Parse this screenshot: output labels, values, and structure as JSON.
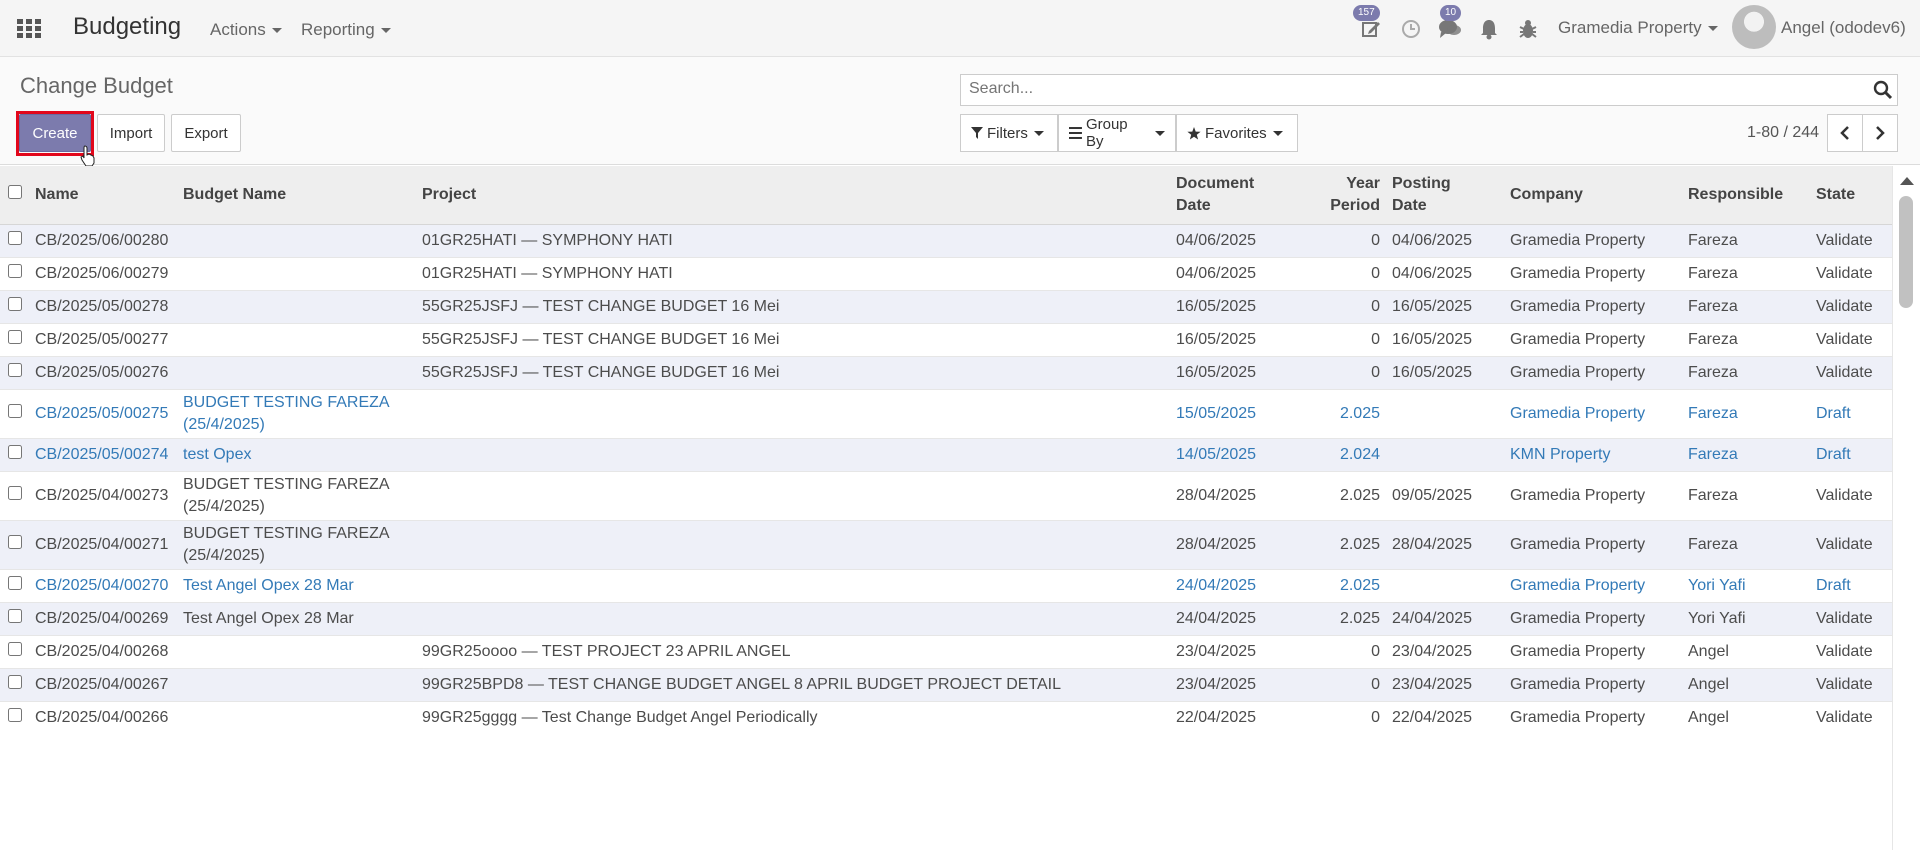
{
  "navbar": {
    "app_title": "Budgeting",
    "menus": [
      "Actions",
      "Reporting"
    ],
    "activity_count": "157",
    "messages_count": "10",
    "company": "Gramedia Property",
    "user": "Angel (ododev6)"
  },
  "control_panel": {
    "page_title": "Change Budget",
    "create_label": "Create",
    "import_label": "Import",
    "export_label": "Export",
    "search_placeholder": "Search...",
    "filters_label": "Filters",
    "groupby_label": "Group By",
    "favorites_label": "Favorites",
    "pager_value": "1-80 / 244"
  },
  "table": {
    "headers": {
      "name": "Name",
      "budget_name": "Budget Name",
      "project": "Project",
      "document_date_1": "Document",
      "document_date_2": "Date",
      "year_period_1": "Year",
      "year_period_2": "Period",
      "posting_date_1": "Posting",
      "posting_date_2": "Date",
      "company": "Company",
      "responsible": "Responsible",
      "state": "State"
    },
    "rows": [
      {
        "name": "CB/2025/06/00280",
        "budget_name": "",
        "project": "01GR25HATI — SYMPHONY HATI",
        "document_date": "04/06/2025",
        "year_period": "0",
        "posting_date": "04/06/2025",
        "company": "Gramedia Property",
        "responsible": "Fareza",
        "state": "Validate"
      },
      {
        "name": "CB/2025/06/00279",
        "budget_name": "",
        "project": "01GR25HATI — SYMPHONY HATI",
        "document_date": "04/06/2025",
        "year_period": "0",
        "posting_date": "04/06/2025",
        "company": "Gramedia Property",
        "responsible": "Fareza",
        "state": "Validate"
      },
      {
        "name": "CB/2025/05/00278",
        "budget_name": "",
        "project": "55GR25JSFJ — TEST CHANGE BUDGET 16 Mei",
        "document_date": "16/05/2025",
        "year_period": "0",
        "posting_date": "16/05/2025",
        "company": "Gramedia Property",
        "responsible": "Fareza",
        "state": "Validate"
      },
      {
        "name": "CB/2025/05/00277",
        "budget_name": "",
        "project": "55GR25JSFJ — TEST CHANGE BUDGET 16 Mei",
        "document_date": "16/05/2025",
        "year_period": "0",
        "posting_date": "16/05/2025",
        "company": "Gramedia Property",
        "responsible": "Fareza",
        "state": "Validate"
      },
      {
        "name": "CB/2025/05/00276",
        "budget_name": "",
        "project": "55GR25JSFJ — TEST CHANGE BUDGET 16 Mei",
        "document_date": "16/05/2025",
        "year_period": "0",
        "posting_date": "16/05/2025",
        "company": "Gramedia Property",
        "responsible": "Fareza",
        "state": "Validate"
      },
      {
        "name": "CB/2025/05/00275",
        "budget_name": "BUDGET TESTING FAREZA (25/4/2025)",
        "project": "",
        "document_date": "15/05/2025",
        "year_period": "2.025",
        "posting_date": "",
        "company": "Gramedia Property",
        "responsible": "Fareza",
        "state": "Draft"
      },
      {
        "name": "CB/2025/05/00274",
        "budget_name": "test Opex",
        "project": "",
        "document_date": "14/05/2025",
        "year_period": "2.024",
        "posting_date": "",
        "company": "KMN Property",
        "responsible": "Fareza",
        "state": "Draft"
      },
      {
        "name": "CB/2025/04/00273",
        "budget_name": "BUDGET TESTING FAREZA (25/4/2025)",
        "project": "",
        "document_date": "28/04/2025",
        "year_period": "2.025",
        "posting_date": "09/05/2025",
        "company": "Gramedia Property",
        "responsible": "Fareza",
        "state": "Validate"
      },
      {
        "name": "CB/2025/04/00271",
        "budget_name": "BUDGET TESTING FAREZA (25/4/2025)",
        "project": "",
        "document_date": "28/04/2025",
        "year_period": "2.025",
        "posting_date": "28/04/2025",
        "company": "Gramedia Property",
        "responsible": "Fareza",
        "state": "Validate"
      },
      {
        "name": "CB/2025/04/00270",
        "budget_name": "Test Angel Opex 28 Mar",
        "project": "",
        "document_date": "24/04/2025",
        "year_period": "2.025",
        "posting_date": "",
        "company": "Gramedia Property",
        "responsible": "Yori Yafi",
        "state": "Draft"
      },
      {
        "name": "CB/2025/04/00269",
        "budget_name": "Test Angel Opex 28 Mar",
        "project": "",
        "document_date": "24/04/2025",
        "year_period": "2.025",
        "posting_date": "24/04/2025",
        "company": "Gramedia Property",
        "responsible": "Yori Yafi",
        "state": "Validate"
      },
      {
        "name": "CB/2025/04/00268",
        "budget_name": "",
        "project": "99GR25oooo — TEST PROJECT 23 APRIL ANGEL",
        "document_date": "23/04/2025",
        "year_period": "0",
        "posting_date": "23/04/2025",
        "company": "Gramedia Property",
        "responsible": "Angel",
        "state": "Validate"
      },
      {
        "name": "CB/2025/04/00267",
        "budget_name": "",
        "project": "99GR25BPD8 — TEST CHANGE BUDGET ANGEL 8 APRIL BUDGET PROJECT DETAIL",
        "document_date": "23/04/2025",
        "year_period": "0",
        "posting_date": "23/04/2025",
        "company": "Gramedia Property",
        "responsible": "Angel",
        "state": "Validate"
      },
      {
        "name": "CB/2025/04/00266",
        "budget_name": "",
        "project": "99GR25gggg — Test Change Budget Angel Periodically",
        "document_date": "22/04/2025",
        "year_period": "0",
        "posting_date": "22/04/2025",
        "company": "Gramedia Property",
        "responsible": "Angel",
        "state": "Validate"
      }
    ]
  }
}
